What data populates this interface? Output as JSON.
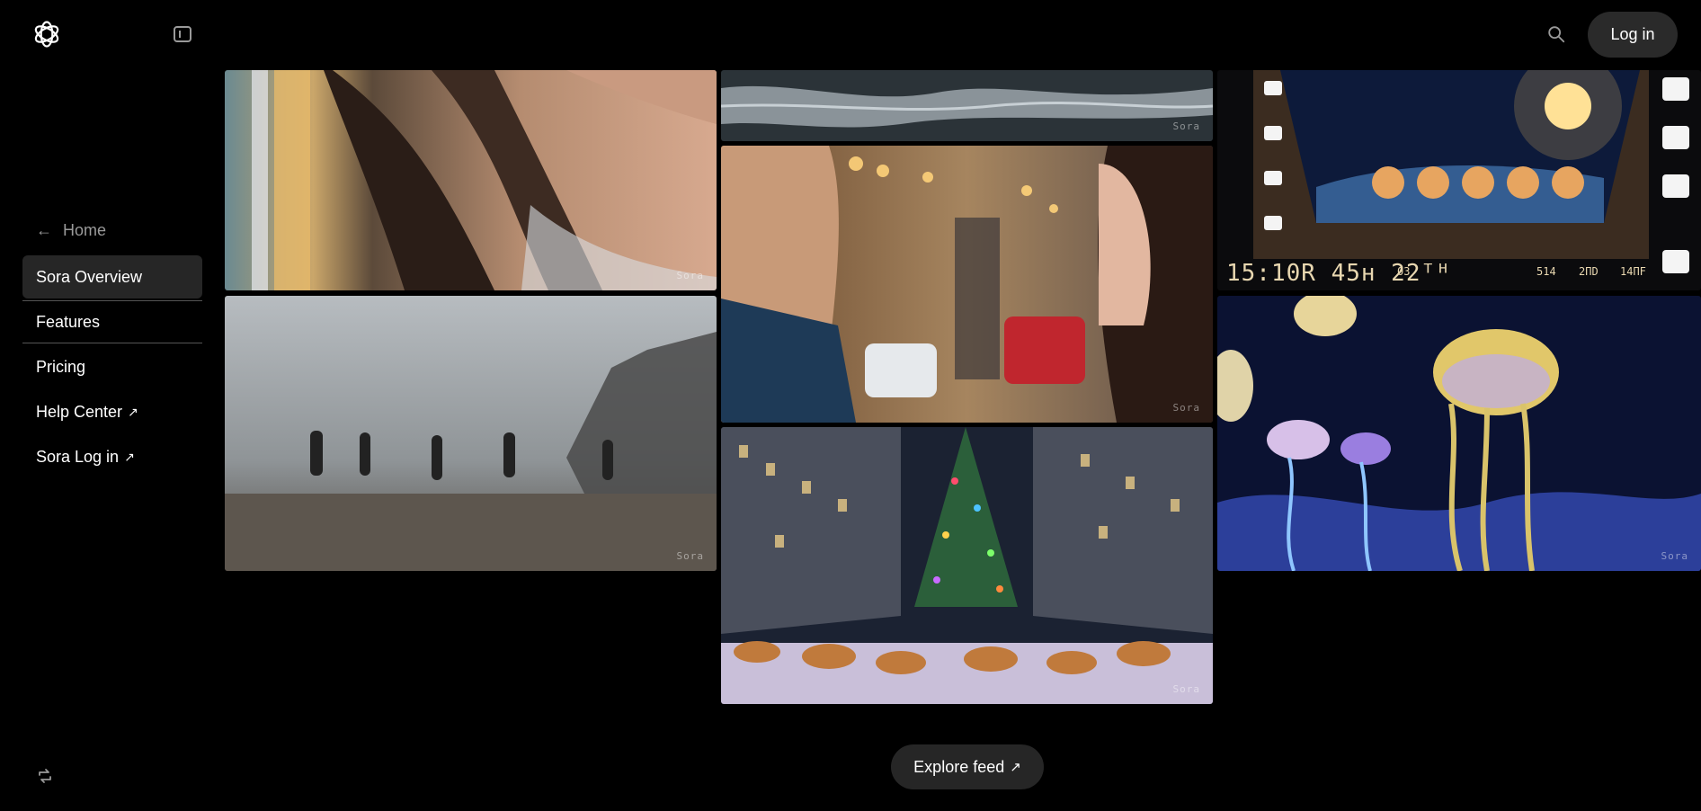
{
  "topbar": {
    "login_label": "Log in",
    "icons": [
      "openai-logo-icon",
      "sidebar-toggle-icon",
      "search-icon"
    ]
  },
  "nav": {
    "home_label": "Home",
    "items": [
      {
        "label": "Sora Overview",
        "active": true,
        "external": false
      },
      {
        "label": "Features",
        "active": false,
        "external": false
      },
      {
        "label": "Pricing",
        "active": false,
        "external": false
      },
      {
        "label": "Help Center",
        "active": false,
        "external": true
      },
      {
        "label": "Sora Log in",
        "active": false,
        "external": true
      }
    ],
    "external_glyph": "↗"
  },
  "gallery": {
    "tiles": [
      {
        "id": "closeup-hair",
        "watermark": "Sora"
      },
      {
        "id": "fog-walkers",
        "watermark": "Sora"
      },
      {
        "id": "reflective-water",
        "watermark": "Sora"
      },
      {
        "id": "couple-hot-drinks",
        "watermark": "Sora"
      },
      {
        "id": "rockefeller-dogs",
        "watermark": "Sora"
      },
      {
        "id": "space-puppies",
        "hud_main": "15:10R 45н 22ᵀᴴ",
        "hud_a": "03",
        "hud_b": "514",
        "hud_c": "2ПD",
        "hud_d": "14ПF"
      },
      {
        "id": "jellyfish",
        "watermark": "Sora"
      }
    ]
  },
  "footer": {
    "explore_label": "Explore feed",
    "explore_glyph": "↗"
  },
  "colors": {
    "background": "#000000",
    "button_bg": "#2a2a2a",
    "muted_text": "#9a9a9a"
  }
}
